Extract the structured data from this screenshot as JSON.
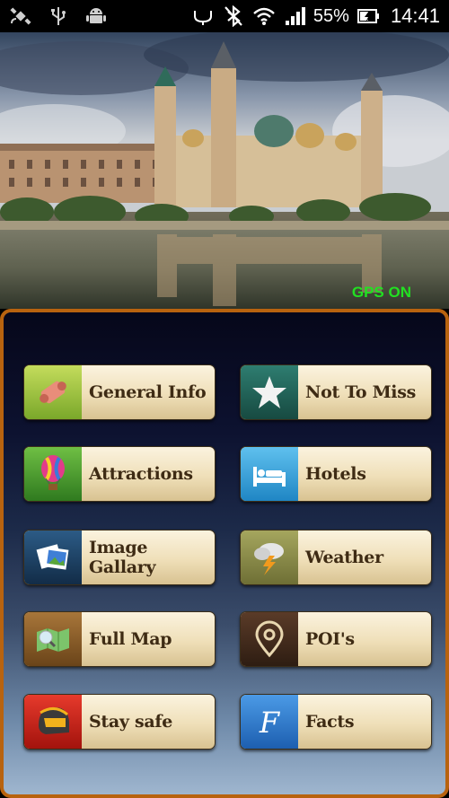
{
  "status_bar": {
    "battery_percent": "55%",
    "time": "14:41"
  },
  "hero": {
    "gps_label": "GPS ON"
  },
  "menu": [
    {
      "label": "General Info",
      "icon": "scroll-icon",
      "icon_bg": "#9bbf3a"
    },
    {
      "label": "Not To Miss",
      "icon": "star-icon",
      "icon_bg": "#1f5f55"
    },
    {
      "label": "Attractions",
      "icon": "balloon-icon",
      "icon_bg": "#4f9a2f"
    },
    {
      "label": "Hotels",
      "icon": "bed-icon",
      "icon_bg": "#3aa2d8"
    },
    {
      "label": "Image Gallary",
      "icon": "photos-icon",
      "icon_bg": "#1a3e63"
    },
    {
      "label": "Weather",
      "icon": "storm-icon",
      "icon_bg": "#8d8e4b"
    },
    {
      "label": "Full Map",
      "icon": "map-icon",
      "icon_bg": "#8a5a25"
    },
    {
      "label": "POI's",
      "icon": "map-pin-icon",
      "icon_bg": "#4a2f1f"
    },
    {
      "label": "Stay safe",
      "icon": "helmet-icon",
      "icon_bg": "#c8221b"
    },
    {
      "label": "Facts",
      "icon": "letter-f-icon",
      "icon_bg": "#2f7ed0"
    }
  ]
}
